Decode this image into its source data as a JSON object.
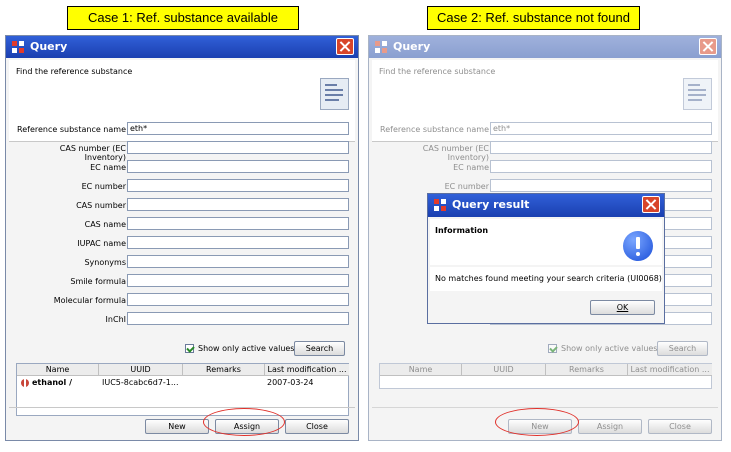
{
  "captions": {
    "case1": "Case 1: Ref. substance available",
    "case2": "Case 2: Ref. substance not found"
  },
  "window": {
    "title": "Query",
    "header_text": "Find the reference substance"
  },
  "fields": [
    {
      "label": "Reference substance name",
      "value": "eth*"
    },
    {
      "label": "CAS number (EC Inventory)",
      "value": ""
    },
    {
      "label": "EC name",
      "value": ""
    },
    {
      "label": "EC number",
      "value": ""
    },
    {
      "label": "CAS number",
      "value": ""
    },
    {
      "label": "CAS name",
      "value": ""
    },
    {
      "label": "IUPAC name",
      "value": ""
    },
    {
      "label": "Synonyms",
      "value": ""
    },
    {
      "label": "Smile formula",
      "value": ""
    },
    {
      "label": "Molecular formula",
      "value": ""
    },
    {
      "label": "InChI",
      "value": ""
    }
  ],
  "checkbox": {
    "label": "Show only active values",
    "checked": true
  },
  "search_button": "Search",
  "table": {
    "columns": [
      "Name",
      "UUID",
      "Remarks",
      "Last modification ..."
    ],
    "row": {
      "name": "ethanol /",
      "uuid": "IUC5-8cabc6d7-1...",
      "remarks": "",
      "last_modification": "2007-03-24"
    }
  },
  "buttons": {
    "new": "New",
    "assign": "Assign",
    "close": "Close"
  },
  "dialog": {
    "title": "Query result",
    "heading": "Information",
    "message": "No matches found meeting your search criteria (UI0068)",
    "ok": "OK"
  },
  "colors": {
    "highlight": "#e0302a",
    "caption_bg": "#ffff00",
    "titlebar": "#2a54c8"
  }
}
